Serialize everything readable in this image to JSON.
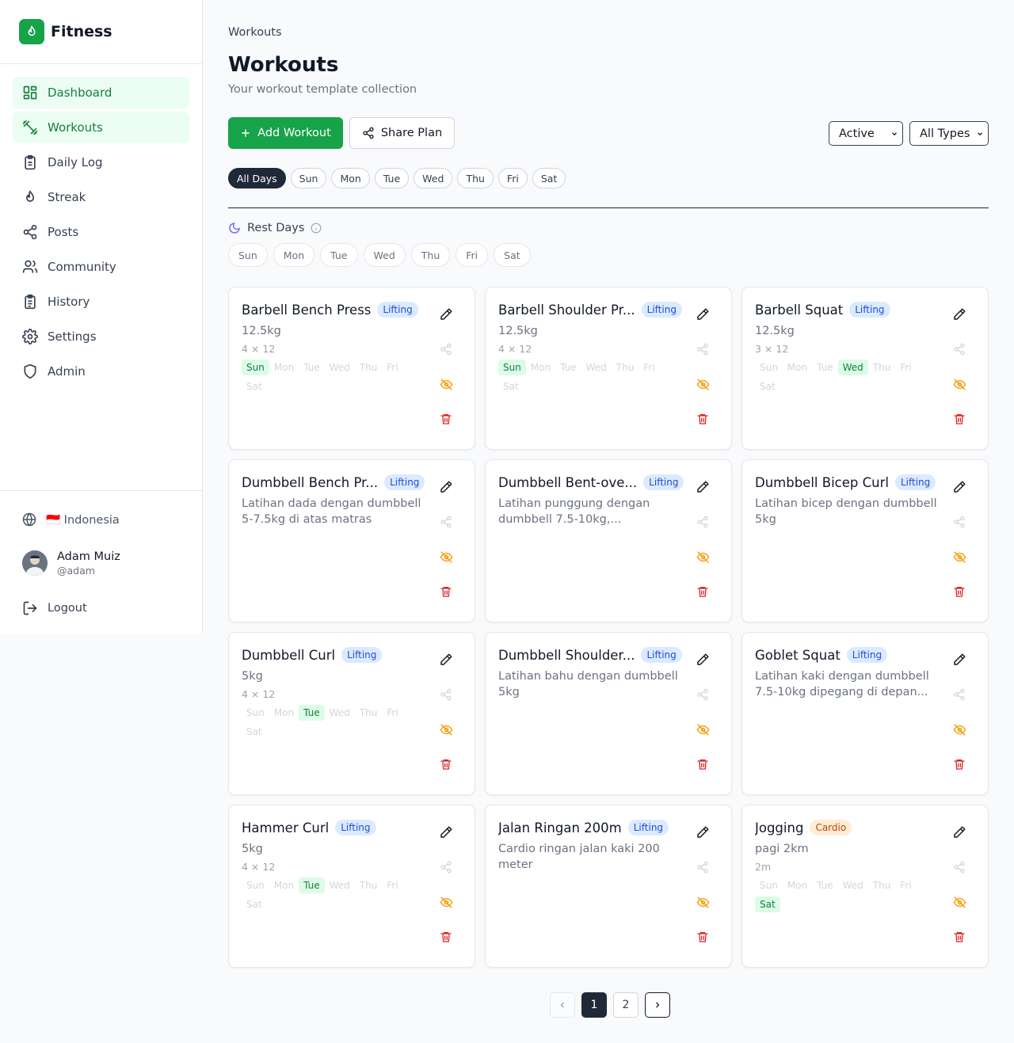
{
  "app": {
    "name": "Fitness"
  },
  "sidebar": {
    "items": [
      {
        "label": "Dashboard",
        "icon": "dashboard-icon",
        "active": true
      },
      {
        "label": "Workouts",
        "icon": "dumbbell-icon",
        "active": true
      },
      {
        "label": "Daily Log",
        "icon": "clipboard-icon",
        "active": false
      },
      {
        "label": "Streak",
        "icon": "flame-icon",
        "active": false
      },
      {
        "label": "Posts",
        "icon": "share-icon",
        "active": false
      },
      {
        "label": "Community",
        "icon": "users-icon",
        "active": false
      },
      {
        "label": "History",
        "icon": "history-icon",
        "active": false
      },
      {
        "label": "Settings",
        "icon": "gear-icon",
        "active": false
      },
      {
        "label": "Admin",
        "icon": "shield-icon",
        "active": false
      }
    ],
    "locale": "🇮🇩 Indonesia",
    "user": {
      "name": "Adam Muiz",
      "handle": "@adam"
    },
    "logout_label": "Logout"
  },
  "main": {
    "breadcrumb": "Workouts",
    "title": "Workouts",
    "subtitle": "Your workout template collection",
    "add_button": "Add Workout",
    "share_button": "Share Plan",
    "status_select": "Active",
    "type_select": "All Types",
    "day_filters": [
      "All Days",
      "Sun",
      "Mon",
      "Tue",
      "Wed",
      "Thu",
      "Fri",
      "Sat"
    ],
    "day_filter_active": "All Days",
    "rest_days_label": "Rest Days",
    "rest_days": [
      "Sun",
      "Mon",
      "Tue",
      "Wed",
      "Thu",
      "Fri",
      "Sat"
    ]
  },
  "workouts": [
    {
      "title": "Barbell Bench Press",
      "type": "Lifting",
      "sub": "12.5kg",
      "sets": "4 × 12",
      "days": [
        "Sun"
      ]
    },
    {
      "title": "Barbell Shoulder Pr...",
      "type": "Lifting",
      "sub": "12.5kg",
      "sets": "4 × 12",
      "days": [
        "Sun"
      ]
    },
    {
      "title": "Barbell Squat",
      "type": "Lifting",
      "sub": "12.5kg",
      "sets": "3 × 12",
      "days": [
        "Wed"
      ]
    },
    {
      "title": "Dumbbell Bench Pr...",
      "type": "Lifting",
      "sub": "Latihan dada dengan dumbbell 5-7.5kg di atas matras",
      "sets": "",
      "days": null
    },
    {
      "title": "Dumbbell Bent-ove...",
      "type": "Lifting",
      "sub": "Latihan punggung dengan dumbbell 7.5-10kg,...",
      "sets": "",
      "days": null
    },
    {
      "title": "Dumbbell Bicep Curl",
      "type": "Lifting",
      "sub": "Latihan bicep dengan dumbbell 5kg",
      "sets": "",
      "days": null
    },
    {
      "title": "Dumbbell Curl",
      "type": "Lifting",
      "sub": "5kg",
      "sets": "4 × 12",
      "days": [
        "Tue"
      ]
    },
    {
      "title": "Dumbbell Shoulder...",
      "type": "Lifting",
      "sub": "Latihan bahu dengan dumbbell 5kg",
      "sets": "",
      "days": null
    },
    {
      "title": "Goblet Squat",
      "type": "Lifting",
      "sub": "Latihan kaki dengan dumbbell 7.5-10kg dipegang di depan...",
      "sets": "",
      "days": null
    },
    {
      "title": "Hammer Curl",
      "type": "Lifting",
      "sub": "5kg",
      "sets": "4 × 12",
      "days": [
        "Tue"
      ]
    },
    {
      "title": "Jalan Ringan 200m",
      "type": "Lifting",
      "sub": "Cardio ringan jalan kaki 200 meter",
      "sets": "",
      "days": null
    },
    {
      "title": "Jogging",
      "type": "Cardio",
      "sub": "pagi 2km",
      "sets": "2m",
      "days": [
        "Sat"
      ]
    }
  ],
  "week_days": [
    "Sun",
    "Mon",
    "Tue",
    "Wed",
    "Thu",
    "Fri",
    "Sat"
  ],
  "pagination": {
    "pages": [
      "1",
      "2"
    ],
    "current": "1"
  },
  "colors": {
    "brand": "#16a34a",
    "edit": "#111827",
    "share": "#d1d5db",
    "hide": "#f59e0b",
    "delete": "#dc2626"
  }
}
